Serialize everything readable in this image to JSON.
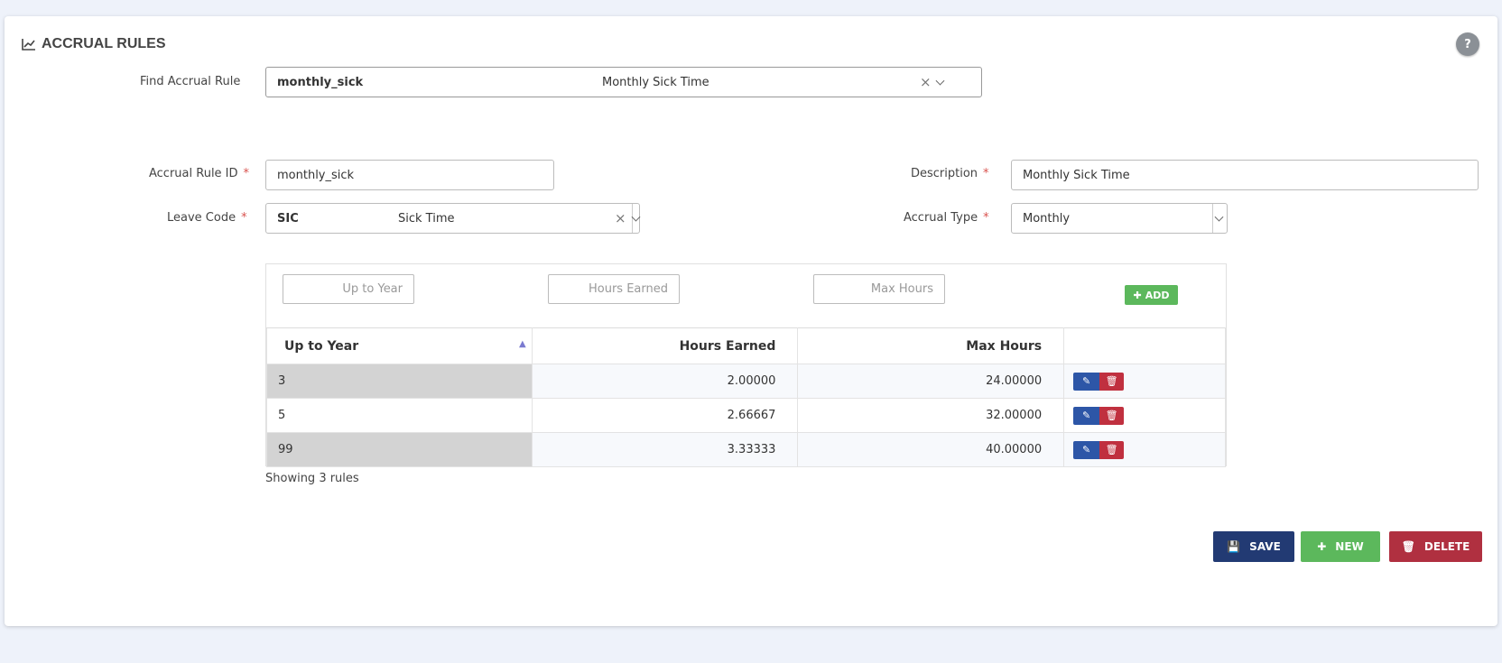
{
  "header": {
    "title": "ACCRUAL RULES",
    "help_label": "?"
  },
  "find": {
    "label": "Find Accrual Rule",
    "code": "monthly_sick",
    "description": "Monthly Sick Time",
    "clear_glyph": "×"
  },
  "form": {
    "accrual_rule_id": {
      "label": "Accrual Rule ID",
      "value": "monthly_sick"
    },
    "description": {
      "label": "Description",
      "value": "Monthly Sick Time"
    },
    "leave_code": {
      "label": "Leave Code",
      "code": "SIC",
      "description": "Sick Time",
      "clear_glyph": "×"
    },
    "accrual_type": {
      "label": "Accrual Type",
      "value": "Monthly"
    },
    "required_mark": "*"
  },
  "add_row": {
    "up_to_year_placeholder": "Up to Year",
    "hours_earned_placeholder": "Hours Earned",
    "max_hours_placeholder": "Max Hours",
    "add_label": "ADD"
  },
  "table": {
    "columns": [
      "Up to Year",
      "Hours Earned",
      "Max Hours"
    ],
    "sort_indicator": "▲",
    "rows": [
      {
        "up_to_year": "3",
        "hours_earned": "2.00000",
        "max_hours": "24.00000"
      },
      {
        "up_to_year": "5",
        "hours_earned": "2.66667",
        "max_hours": "32.00000"
      },
      {
        "up_to_year": "99",
        "hours_earned": "3.33333",
        "max_hours": "40.00000"
      }
    ]
  },
  "status": {
    "showing": "Showing 3 rules"
  },
  "actions": {
    "save": "SAVE",
    "new": "NEW",
    "delete": "DELETE"
  },
  "colors": {
    "save": "#223a73",
    "new": "#5cb85c",
    "delete": "#b03040",
    "edit": "#2d56a7"
  },
  "icons": {
    "title": "line-chart-icon",
    "add": "plus-icon",
    "save": "floppy-disk-icon",
    "new": "plus-icon",
    "delete": "trash-icon",
    "edit": "edit-icon"
  }
}
